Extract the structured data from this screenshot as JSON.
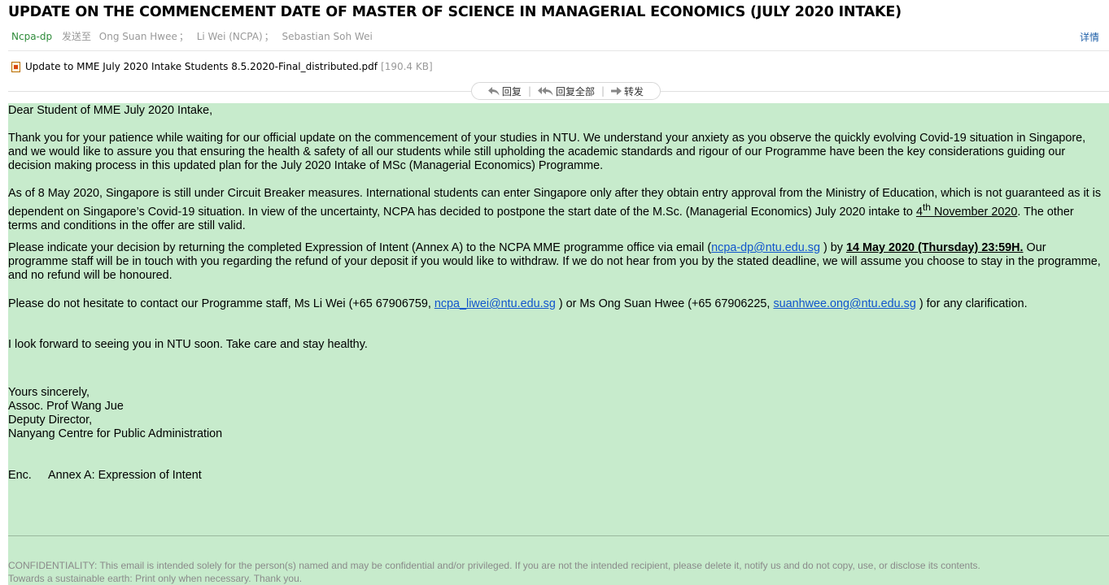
{
  "email": {
    "subject": "UPDATE ON THE COMMENCEMENT DATE OF MASTER OF SCIENCE IN MANAGERIAL    ECONOMICS (JULY 2020 INTAKE)",
    "sender": "Ncpa-dp",
    "sent_to_label": "发送至",
    "recipients": [
      "Ong Suan Hwee",
      "Li Wei (NCPA)",
      "Sebastian Soh Wei"
    ],
    "recipient_sep": "；",
    "details_link": "详情",
    "attachment": {
      "filename": "Update to MME July 2020 Intake Students 8.5.2020-Final_distributed.pdf",
      "size": "[190.4 KB]"
    },
    "actions": {
      "reply": "回复",
      "reply_all": "回复全部",
      "forward": "转发",
      "sep": "|"
    }
  },
  "body": {
    "greeting": "Dear Student of MME July 2020 Intake,",
    "p1": "Thank you for your patience while waiting for our official update on the commencement of your studies in NTU. We understand your anxiety as you observe the quickly evolving Covid-19 situation in Singapore, and we would like to assure you that ensuring the health & safety of all our students while still upholding the academic standards and rigour of our Programme have been the key considerations guiding our decision making process in this updated plan for the July 2020 Intake of MSc (Managerial Economics) Programme.",
    "p2": {
      "before": "As of 8 May 2020, Singapore is still under Circuit Breaker measures. International students can enter Singapore only after they obtain entry approval from the Ministry of Education, which is not guaranteed as it is dependent on Singapore’s Covid-19 situation. In view of the uncertainty, NCPA has decided to postpone the start date of the M.Sc. (Managerial Economics) July 2020 intake to ",
      "day": "4",
      "sup": "th",
      "month": " November 2020",
      "after": ". The other terms and conditions in the offer are still valid."
    },
    "p3": {
      "before": "Please indicate your decision by returning the completed Expression of Intent (Annex A) to the NCPA MME programme office via email (",
      "email": "ncpa-dp@ntu.edu.sg",
      "mid": " ) by ",
      "deadline": "14 May 2020 (Thursday) 23:59H.",
      "after": " Our programme staff will be in touch with you regarding the refund of your deposit if you would like to withdraw. If we do not hear from you by the stated deadline, we will assume you choose to stay in the programme, and no refund will be honoured."
    },
    "p4": {
      "before": "Please do not hesitate to contact our Programme staff, Ms Li Wei (+65 67906759, ",
      "email1": "ncpa_liwei@ntu.edu.sg",
      "mid": " ) or Ms Ong Suan Hwee (+65 67906225, ",
      "email2": "suanhwee.ong@ntu.edu.sg",
      "after": " ) for any clarification."
    },
    "p5": "I look forward to seeing you in NTU soon. Take care and stay healthy.",
    "signature": [
      "Yours sincerely,",
      "Assoc. Prof Wang Jue",
      "Deputy Director,",
      "Nanyang Centre for Public Administration"
    ],
    "enc_label": "Enc.",
    "enc_value": "Annex A: Expression of Intent",
    "confidentiality": "CONFIDENTIALITY: This email is intended solely for the person(s) named and may be confidential and/or privileged. If you are not the intended recipient, please delete it, notify us and do not copy, use, or disclose its contents.",
    "footer": "Towards a sustainable earth: Print only when necessary. Thank you."
  }
}
